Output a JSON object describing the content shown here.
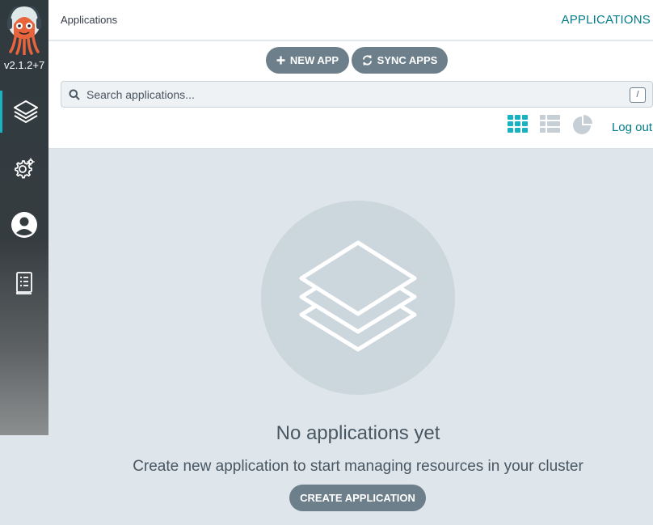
{
  "sidebar": {
    "version": "v2.1.2+7",
    "items": [
      {
        "name": "applications",
        "icon": "layers-icon",
        "active": true
      },
      {
        "name": "settings",
        "icon": "gears-icon",
        "active": false
      },
      {
        "name": "user-info",
        "icon": "user-circle-icon",
        "active": false
      },
      {
        "name": "documentation",
        "icon": "book-icon",
        "active": false
      }
    ]
  },
  "header": {
    "breadcrumb": "Applications",
    "title": "APPLICATIONS"
  },
  "toolbar": {
    "new_app_label": "NEW APP",
    "sync_apps_label": "SYNC APPS"
  },
  "search": {
    "placeholder": "Search applications...",
    "value": "",
    "shortcut": "/"
  },
  "view_modes": [
    {
      "name": "tiles",
      "icon": "grid-icon",
      "active": true
    },
    {
      "name": "list",
      "icon": "list-icon",
      "active": false
    },
    {
      "name": "summary",
      "icon": "pie-chart-icon",
      "active": false
    }
  ],
  "logout_label": "Log out",
  "empty_state": {
    "title": "No applications yet",
    "subtitle": "Create new application to start managing resources in your cluster",
    "button_label": "CREATE APPLICATION"
  },
  "colors": {
    "accent": "#18b2c3",
    "accent_text": "#007c8a",
    "button": "#6d7f8b",
    "background": "#dee6eb"
  }
}
